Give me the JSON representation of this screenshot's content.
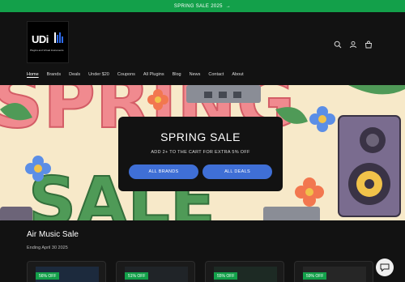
{
  "announcement": {
    "text": "SPRING SALE 2025",
    "arrow_icon": "arrow-right-icon"
  },
  "header": {
    "logo": {
      "mark": "UDi",
      "tagline": "Plugins and Virtual Instruments"
    },
    "icons": [
      "search-icon",
      "account-icon",
      "cart-icon"
    ]
  },
  "nav": {
    "items": [
      {
        "label": "Home",
        "active": true
      },
      {
        "label": "Brands"
      },
      {
        "label": "Deals"
      },
      {
        "label": "Under $20"
      },
      {
        "label": "Coupons"
      },
      {
        "label": "All Plugins"
      },
      {
        "label": "Blog"
      },
      {
        "label": "News"
      },
      {
        "label": "Contact"
      },
      {
        "label": "About"
      }
    ]
  },
  "hero": {
    "background_words": [
      "SPRING",
      "SALE"
    ],
    "modal": {
      "title": "SPRING SALE",
      "subtitle": "ADD 2+ TO THE CART FOR EXTRA 5% OFF",
      "buttons": [
        {
          "label": "ALL BRANDS"
        },
        {
          "label": "ALL DEALS"
        }
      ]
    }
  },
  "section": {
    "title": "Air Music Sale",
    "subtitle": "Ending April 30 2025",
    "cards": [
      {
        "badge": "56% OFF"
      },
      {
        "badge": "51% OFF"
      },
      {
        "badge": "55% OFF"
      },
      {
        "badge": "59% OFF"
      }
    ]
  },
  "colors": {
    "accent_green": "#13a04a",
    "button_blue": "#3f6fd6",
    "background": "#121212"
  }
}
